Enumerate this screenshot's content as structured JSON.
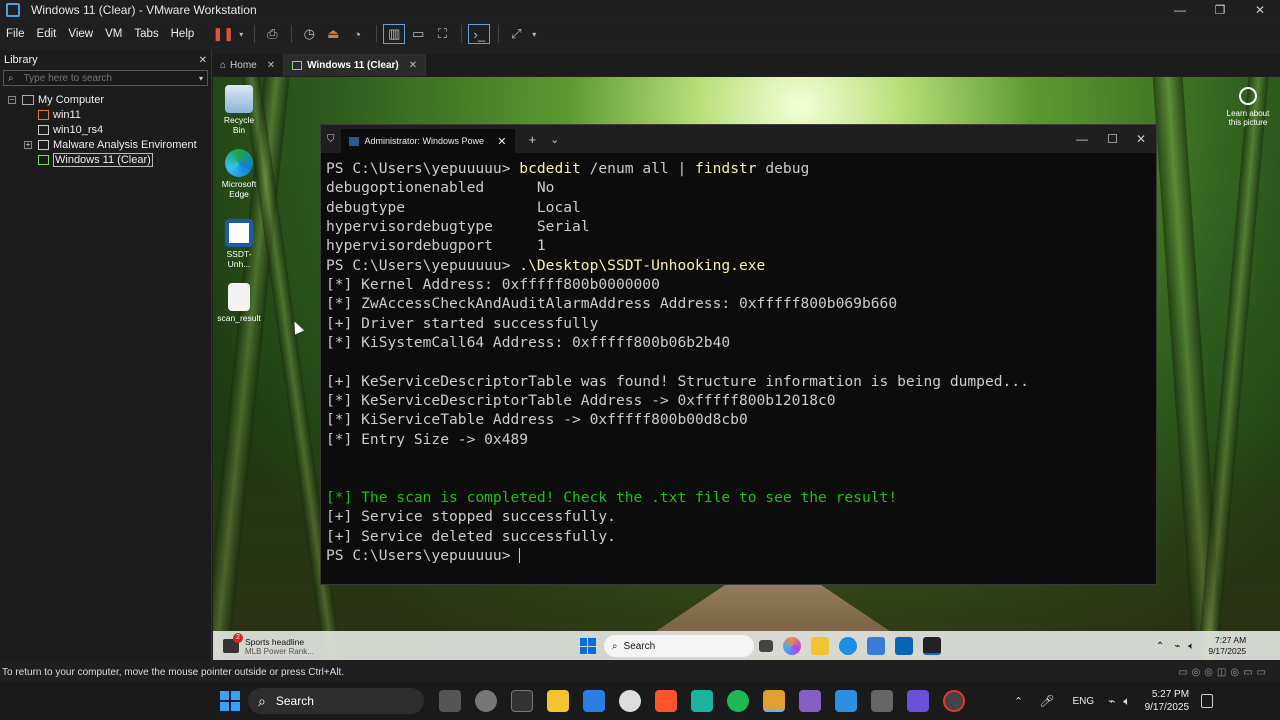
{
  "window": {
    "title": "Windows 11 (Clear) - VMware Workstation",
    "minimize": "—",
    "maximize": "❐",
    "close": "✕"
  },
  "menu": [
    "File",
    "Edit",
    "View",
    "VM",
    "Tabs",
    "Help"
  ],
  "library": {
    "title": "Library",
    "close": "✕",
    "search_placeholder": "Type here to search",
    "tree": {
      "root": "My Computer",
      "items": [
        "win11",
        "win10_rs4",
        "Malware Analysis Enviroment",
        "Windows 11 (Clear)"
      ]
    }
  },
  "tabs": [
    {
      "label": "Home",
      "close": "✕"
    },
    {
      "label": "Windows 11 (Clear)",
      "close": "✕"
    }
  ],
  "desktop": {
    "icons": [
      "Recycle Bin",
      "Microsoft Edge",
      "SSDT-Unh...",
      "scan_result"
    ],
    "learn_about": "Learn about this picture"
  },
  "terminal": {
    "tab_title": "Administrator: Windows Powe",
    "tab_close": "✕",
    "new_tab": "+",
    "dropdown": "⌄",
    "lines": [
      {
        "prompt": "PS C:\\Users\\yepuuuuu> ",
        "cmd": "bcdedit",
        "rest": " /enum all | ",
        "cmd2": "findstr",
        "rest2": " debug"
      },
      {
        "text": "debugoptionenabled      No"
      },
      {
        "text": "debugtype               Local"
      },
      {
        "text": "hypervisordebugtype     Serial"
      },
      {
        "text": "hypervisordebugport     1"
      },
      {
        "prompt": "PS C:\\Users\\yepuuuuu> ",
        "cmd": ".\\Desktop\\SSDT-Unhooking.exe",
        "rest": "",
        "cmd2": "",
        "rest2": ""
      },
      {
        "text": "[*] Kernel Address: 0xfffff800b0000000"
      },
      {
        "text": "[*] ZwAccessCheckAndAuditAlarmAddress Address: 0xfffff800b069b660"
      },
      {
        "text": "[+] Driver started successfully"
      },
      {
        "text": "[*] KiSystemCall64 Address: 0xfffff800b06b2b40"
      },
      {
        "text": ""
      },
      {
        "text": "[+] KeServiceDescriptorTable was found! Structure information is being dumped..."
      },
      {
        "text": "[*] KeServiceDescriptorTable Address -> 0xfffff800b12018c0"
      },
      {
        "text": "[*] KiServiceTable Address -> 0xfffff800b00d8cb0"
      },
      {
        "text": "[*] Entry Size -> 0x489"
      },
      {
        "text": ""
      },
      {
        "text": ""
      },
      {
        "text": "[*] The scan is completed! Check the .txt file to see the result!",
        "green": true
      },
      {
        "text": "[+] Service stopped successfully."
      },
      {
        "text": "[+] Service deleted successfully."
      },
      {
        "prompt": "PS C:\\Users\\yepuuuuu> ",
        "cmd": "",
        "rest": "",
        "cmd2": "",
        "rest2": "",
        "cursor": true
      }
    ]
  },
  "guest_taskbar": {
    "widget_title": "Sports headline",
    "widget_sub": "MLB Power Rank...",
    "widget_badge": "2",
    "search": "Search",
    "tray_lang": "",
    "time": "7:27 AM",
    "date": "9/17/2025"
  },
  "status": "To return to your computer, move the mouse pointer outside or press Ctrl+Alt.",
  "host_taskbar": {
    "search": "Search",
    "lang": "ENG",
    "time": "5:27 PM",
    "date": "9/17/2025"
  },
  "colors": {
    "prompt_cmd": "#f9f1a5",
    "green": "#16c60c",
    "text": "#cccccc"
  }
}
